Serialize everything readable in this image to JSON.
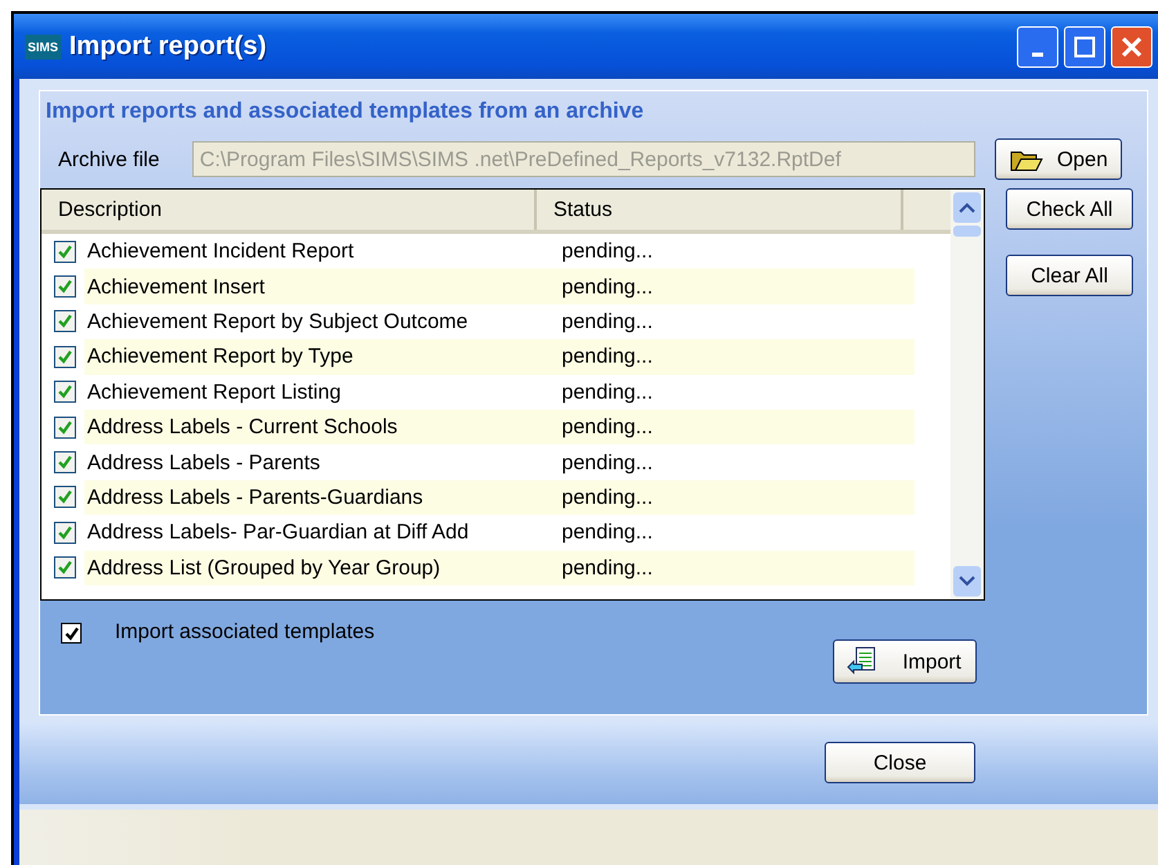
{
  "window": {
    "icon_text": "SIMS",
    "title": "Import report(s)"
  },
  "heading": "Import reports and associated templates from an archive",
  "archive": {
    "label": "Archive file",
    "value": "C:\\Program Files\\SIMS\\SIMS .net\\PreDefined_Reports_v7132.RptDef",
    "disabled": true,
    "button": "Open"
  },
  "table": {
    "columns": [
      "Description",
      "Status"
    ],
    "rows": [
      {
        "description": "Achievement Incident Report",
        "status": "pending...",
        "checked": true
      },
      {
        "description": "Achievement Insert",
        "status": "pending...",
        "checked": true
      },
      {
        "description": "Achievement Report by Subject Outcome",
        "status": "pending...",
        "checked": true
      },
      {
        "description": "Achievement Report by Type",
        "status": "pending...",
        "checked": true
      },
      {
        "description": "Achievement Report Listing",
        "status": "pending...",
        "checked": true
      },
      {
        "description": "Address Labels - Current Schools",
        "status": "pending...",
        "checked": true
      },
      {
        "description": "Address Labels - Parents",
        "status": "pending...",
        "checked": true
      },
      {
        "description": "Address Labels - Parents-Guardians",
        "status": "pending...",
        "checked": true
      },
      {
        "description": "Address Labels- Par-Guardian at Diff Add",
        "status": "pending...",
        "checked": true
      },
      {
        "description": "Address List (Grouped by Year Group)",
        "status": "pending...",
        "checked": true
      }
    ]
  },
  "side_buttons": [
    "Check All",
    "Clear All"
  ],
  "import_templates": {
    "label": "Import associated templates",
    "checked": true
  },
  "import_button": "Import",
  "close_button": "Close"
}
